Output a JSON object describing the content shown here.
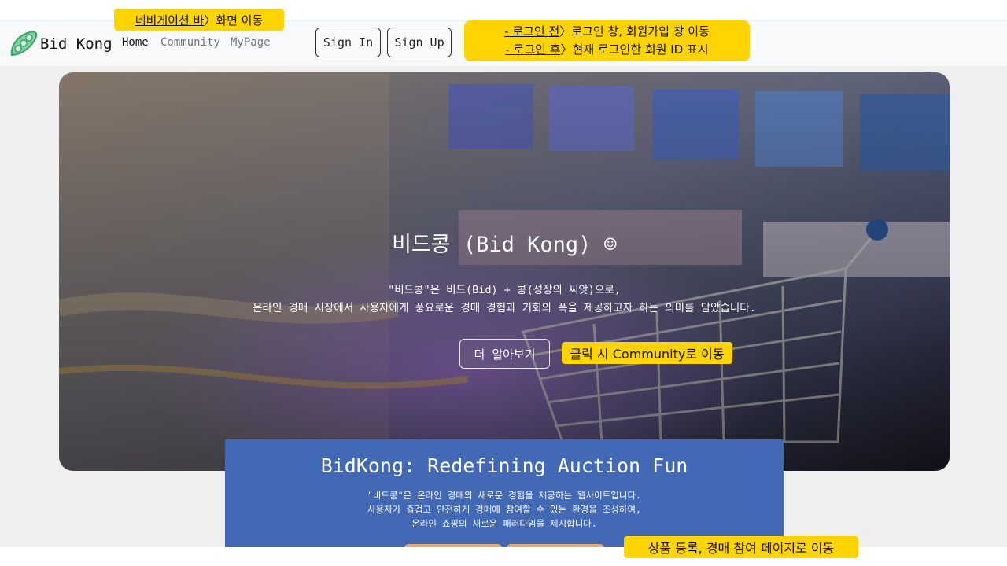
{
  "annotations": {
    "nav": {
      "underlined": "네비게이션 바",
      "rest": "〉화면 이동"
    },
    "login": {
      "line1_underlined": "- 로그인 전",
      "line1_rest": "〉로그인 창, 회원가입 창 이동",
      "line2_underlined": "- 로그인 후",
      "line2_rest": "〉현재 로그인한 회원 ID 표시"
    },
    "learn_more": "클릭 시 Community로 이동",
    "bottom": "상품 등록, 경매 참여 페이지로 이동",
    "color": "#ffd400"
  },
  "navbar": {
    "brand": "Bid Kong",
    "logo_icon": "pea-pod-icon",
    "links": [
      "Home",
      "Community",
      "MyPage"
    ],
    "active": "Home",
    "sign_in": "Sign In",
    "sign_up": "Sign Up"
  },
  "hero": {
    "title": "비드콩 (Bid Kong) ☺",
    "line1": "\"비드콩\"은 비드(Bid) + 콩(성장의 씨앗)으로,",
    "line2": "온라인 경매 시장에서 사용자에게 풍요로운 경매 경험과 기회의 폭을 제공하고자 하는 의미를 담았습니다.",
    "button": "더 알아보기",
    "background_icon": "shopping-cart-photo"
  },
  "feature": {
    "title": "BidKong: Redefining Auction Fun",
    "line1": "\"비드콩\"은 온라인 경매의 새로운 경험을 제공하는 웹사이트입니다.",
    "line2": "사용자가 즐겁고 안전하게 경매에 참여할 수 있는 환경을 조성하여,",
    "line3": "온라인 쇼핑의 새로운 패러다임을 제시합니다.",
    "bg_color": "#4169b5",
    "button_color": "#e9a86f"
  }
}
